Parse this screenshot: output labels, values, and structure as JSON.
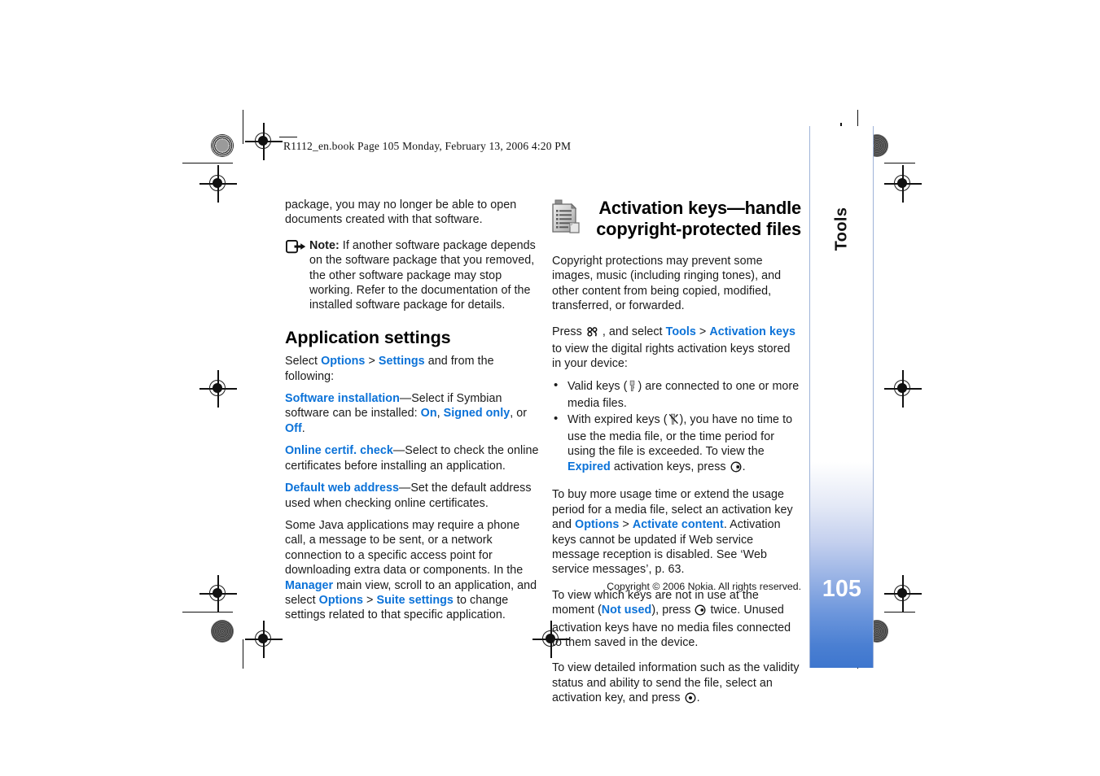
{
  "slug": {
    "text": "R1112_en.book  Page 105  Monday, February 13, 2006  4:20 PM"
  },
  "colors": {
    "link_blue": "#0b72d8",
    "tab_blue_dark": "#3e76ce",
    "tab_blue_mid": "#6c96dc",
    "page_number_color": "#ffffff",
    "body_text": "#1a1a1a"
  },
  "left_column": {
    "continued_paragraph": "package, you may no longer be able to open documents created with that software.",
    "note": {
      "icon": "note-pointer-icon",
      "label": "Note:",
      "text": " If another software package depends on the software package that you removed, the other software package may stop working. Refer to the documentation of the installed software package for details."
    },
    "heading": "Application settings",
    "intro": {
      "pre": "Select ",
      "link1": "Options",
      "sep": " > ",
      "link2": "Settings",
      "post": " and from the following:"
    },
    "items": [
      {
        "term": "Software installation",
        "desc_pre": "—Select if Symbian software can be installed: ",
        "opt1": "On",
        "opt_sep1": ", ",
        "opt2": "Signed only",
        "opt_sep2": ", or ",
        "opt3": "Off",
        "desc_post": "."
      },
      {
        "term": "Online certif. check",
        "desc_pre": "—Select to check the online certificates before installing an application.",
        "opt1": "",
        "opt_sep1": "",
        "opt2": "",
        "opt_sep2": "",
        "opt3": "",
        "desc_post": ""
      },
      {
        "term": "Default web address",
        "desc_pre": "—Set the default address used when checking online certificates.",
        "opt1": "",
        "opt_sep1": "",
        "opt2": "",
        "opt_sep2": "",
        "opt3": "",
        "desc_post": ""
      }
    ],
    "java_paragraph": {
      "part1": "Some Java applications may require a phone call, a message to be sent, or a network connection to a specific access point for downloading extra data or components. In the ",
      "link1": "Manager",
      "part2": " main view, scroll to an application, and select ",
      "link2": "Options",
      "part3": " > ",
      "link3": "Suite settings",
      "part4": " to change settings related to that specific application."
    }
  },
  "right_column": {
    "heading_icon": "activation-keys-document-icon",
    "heading": "Activation keys—handle copyright-protected files",
    "intro_paragraph": "Copyright protections may prevent some images, music (including ringing tones), and other content from being copied, modified, transferred, or forwarded.",
    "press_paragraph": {
      "pre": "Press ",
      "icon": "menu-key-icon",
      "mid": " , and select ",
      "link1": "Tools",
      "sep": " > ",
      "link2": "Activation keys",
      "post": " to view the digital rights activation keys stored in your device:"
    },
    "bullets": [
      {
        "pre": "Valid keys (",
        "icon": "valid-key-icon",
        "mid": ") are connected to one or more media files.",
        "link": "",
        "post": ""
      },
      {
        "pre": "With expired keys (",
        "icon": "expired-key-icon",
        "mid": "), you have no time to use the media file, or the time period for using the file is exceeded. To view the ",
        "link": "Expired",
        "post": " activation keys, press "
      }
    ],
    "bullet2_trailing_icon": "scroll-right-key-icon",
    "bullet2_trailing_text": ".",
    "buy_paragraph": {
      "part1": "To buy more usage time or extend the usage period for a media file, select an activation key and ",
      "link1": "Options",
      "part2": " > ",
      "link2": "Activate content",
      "part3": ". Activation keys cannot be updated if Web service message reception is disabled. See ‘Web service messages’, p. 63."
    },
    "not_used_paragraph": {
      "part1": "To view which keys are not in use at the moment (",
      "link1": "Not used",
      "part2": "), press ",
      "icon": "scroll-right-key-icon",
      "part3": " twice. Unused activation keys have no media files connected to them saved in the device."
    },
    "detail_paragraph": {
      "part1": "To view detailed information such as the validity status and ability to send the file, select an activation key, and press ",
      "icon": "select-key-icon",
      "part2": "."
    }
  },
  "footer": {
    "copyright": "Copyright © 2006 Nokia. All rights reserved."
  },
  "tab": {
    "label": "Tools",
    "page_number": "105"
  }
}
